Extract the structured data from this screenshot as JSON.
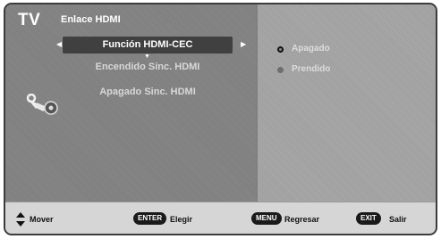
{
  "header": {
    "tv_label": "TV",
    "section_title": "Enlace HDMI"
  },
  "menu": {
    "items": [
      {
        "label": "Función HDMI-CEC",
        "selected": true
      },
      {
        "label": "Encendido Sinc. HDMI",
        "selected": false
      },
      {
        "label": "Apagado Sinc. HDMI",
        "selected": false
      }
    ]
  },
  "options": {
    "items": [
      {
        "label": "Apagado",
        "selected": true
      },
      {
        "label": "Prendido",
        "selected": false
      }
    ]
  },
  "footer": {
    "move_label": "Mover",
    "enter_key": "ENTER",
    "enter_label": "Elegir",
    "menu_key": "MENU",
    "menu_label": "Regresar",
    "exit_key": "EXIT",
    "exit_label": "Salir"
  },
  "icons": {
    "category": "setup-tool-icon",
    "move": "up-down-arrows-icon"
  }
}
